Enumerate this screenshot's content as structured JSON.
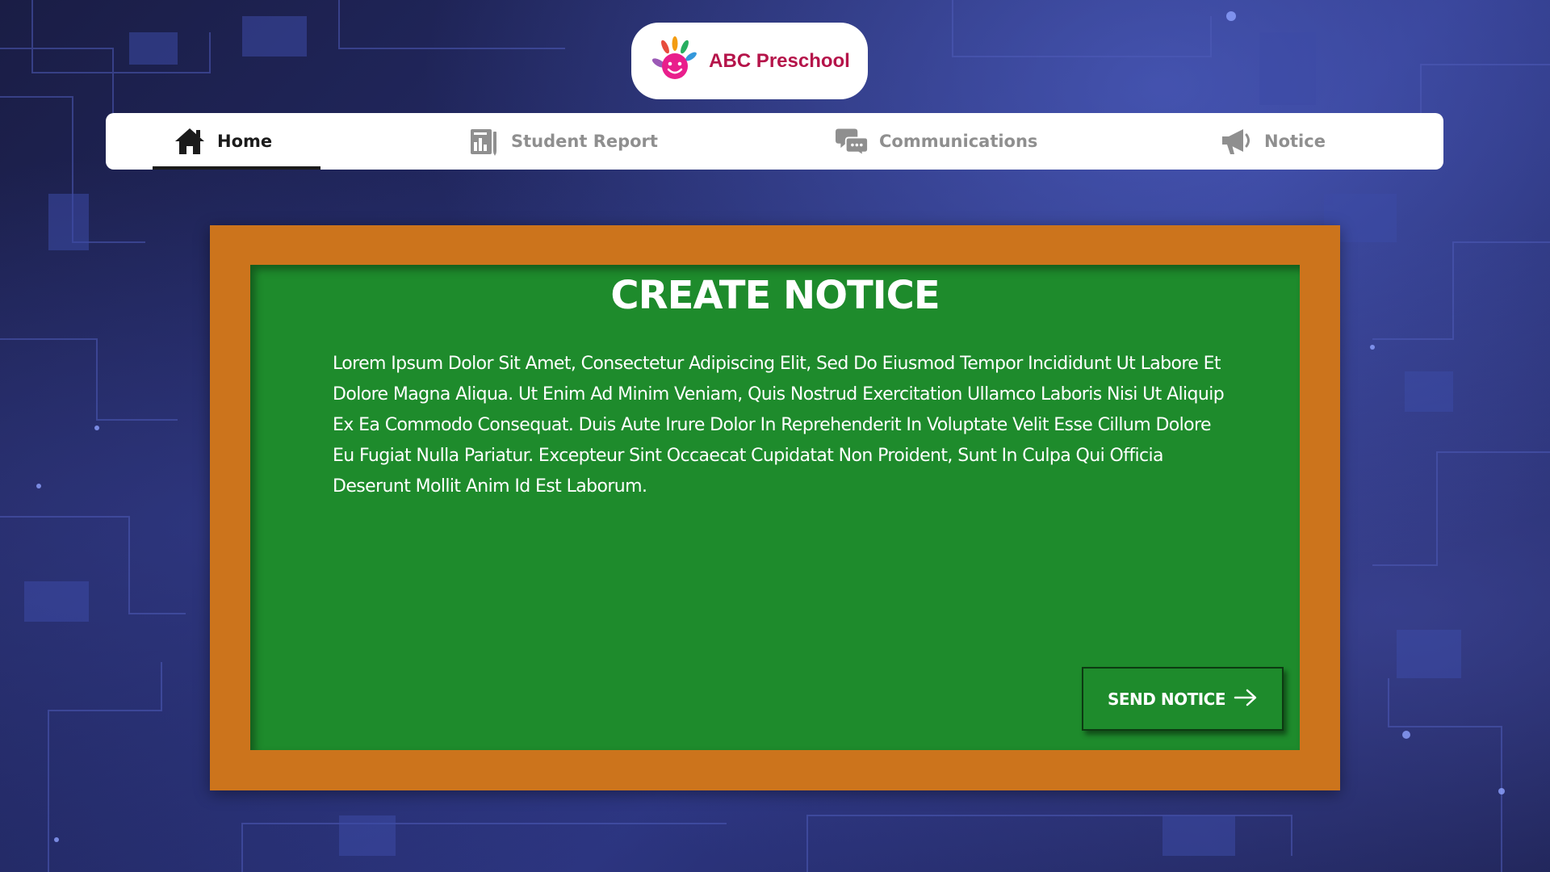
{
  "logo": {
    "text": "ABC Preschool",
    "icon": "hand-smiley-logo-icon"
  },
  "nav": {
    "items": [
      {
        "label": "Home",
        "icon": "home-icon",
        "active": true
      },
      {
        "label": "Student Report",
        "icon": "report-icon",
        "active": false
      },
      {
        "label": "Communications",
        "icon": "chat-bubbles-icon",
        "active": false
      },
      {
        "label": "Notice",
        "icon": "megaphone-icon",
        "active": false
      }
    ]
  },
  "notice": {
    "title": "CREATE NOTICE",
    "body": "Lorem Ipsum Dolor Sit Amet, Consectetur Adipiscing Elit, Sed Do Eiusmod Tempor Incididunt Ut Labore Et Dolore Magna Aliqua. Ut Enim Ad Minim Veniam, Quis Nostrud Exercitation Ullamco Laboris Nisi Ut Aliquip Ex Ea Commodo Consequat. Duis Aute Irure Dolor In Reprehenderit In Voluptate Velit Esse Cillum Dolore Eu Fugiat Nulla Pariatur. Excepteur Sint Occaecat Cupidatat Non Proident, Sunt In Culpa Qui Officia Deserunt Mollit Anim Id Est Laborum.",
    "send_label": "SEND NOTICE"
  },
  "colors": {
    "frame": "#cc741c",
    "board": "#1e8b2c",
    "logo_text": "#b5144a",
    "background": "#232a66"
  }
}
